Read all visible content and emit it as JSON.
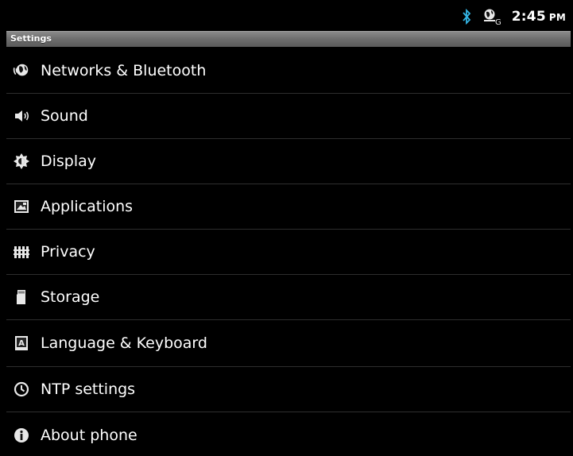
{
  "status_bar": {
    "time": "2:45",
    "ampm": "PM",
    "icons": [
      "bluetooth-icon",
      "gps-icon"
    ],
    "bluetooth_color": "#33b5e5"
  },
  "title_bar": {
    "title": "Settings"
  },
  "settings": [
    {
      "label": "Networks & Bluetooth",
      "icon": "globe-wireless-icon"
    },
    {
      "label": "Sound",
      "icon": "speaker-icon"
    },
    {
      "label": "Display",
      "icon": "brightness-icon"
    },
    {
      "label": "Applications",
      "icon": "applications-icon"
    },
    {
      "label": "Privacy",
      "icon": "fence-icon"
    },
    {
      "label": "Storage",
      "icon": "sd-card-icon"
    },
    {
      "label": "Language & Keyboard",
      "icon": "keyboard-icon"
    },
    {
      "label": "NTP settings",
      "icon": "clock-icon"
    },
    {
      "label": "About phone",
      "icon": "info-icon"
    }
  ]
}
